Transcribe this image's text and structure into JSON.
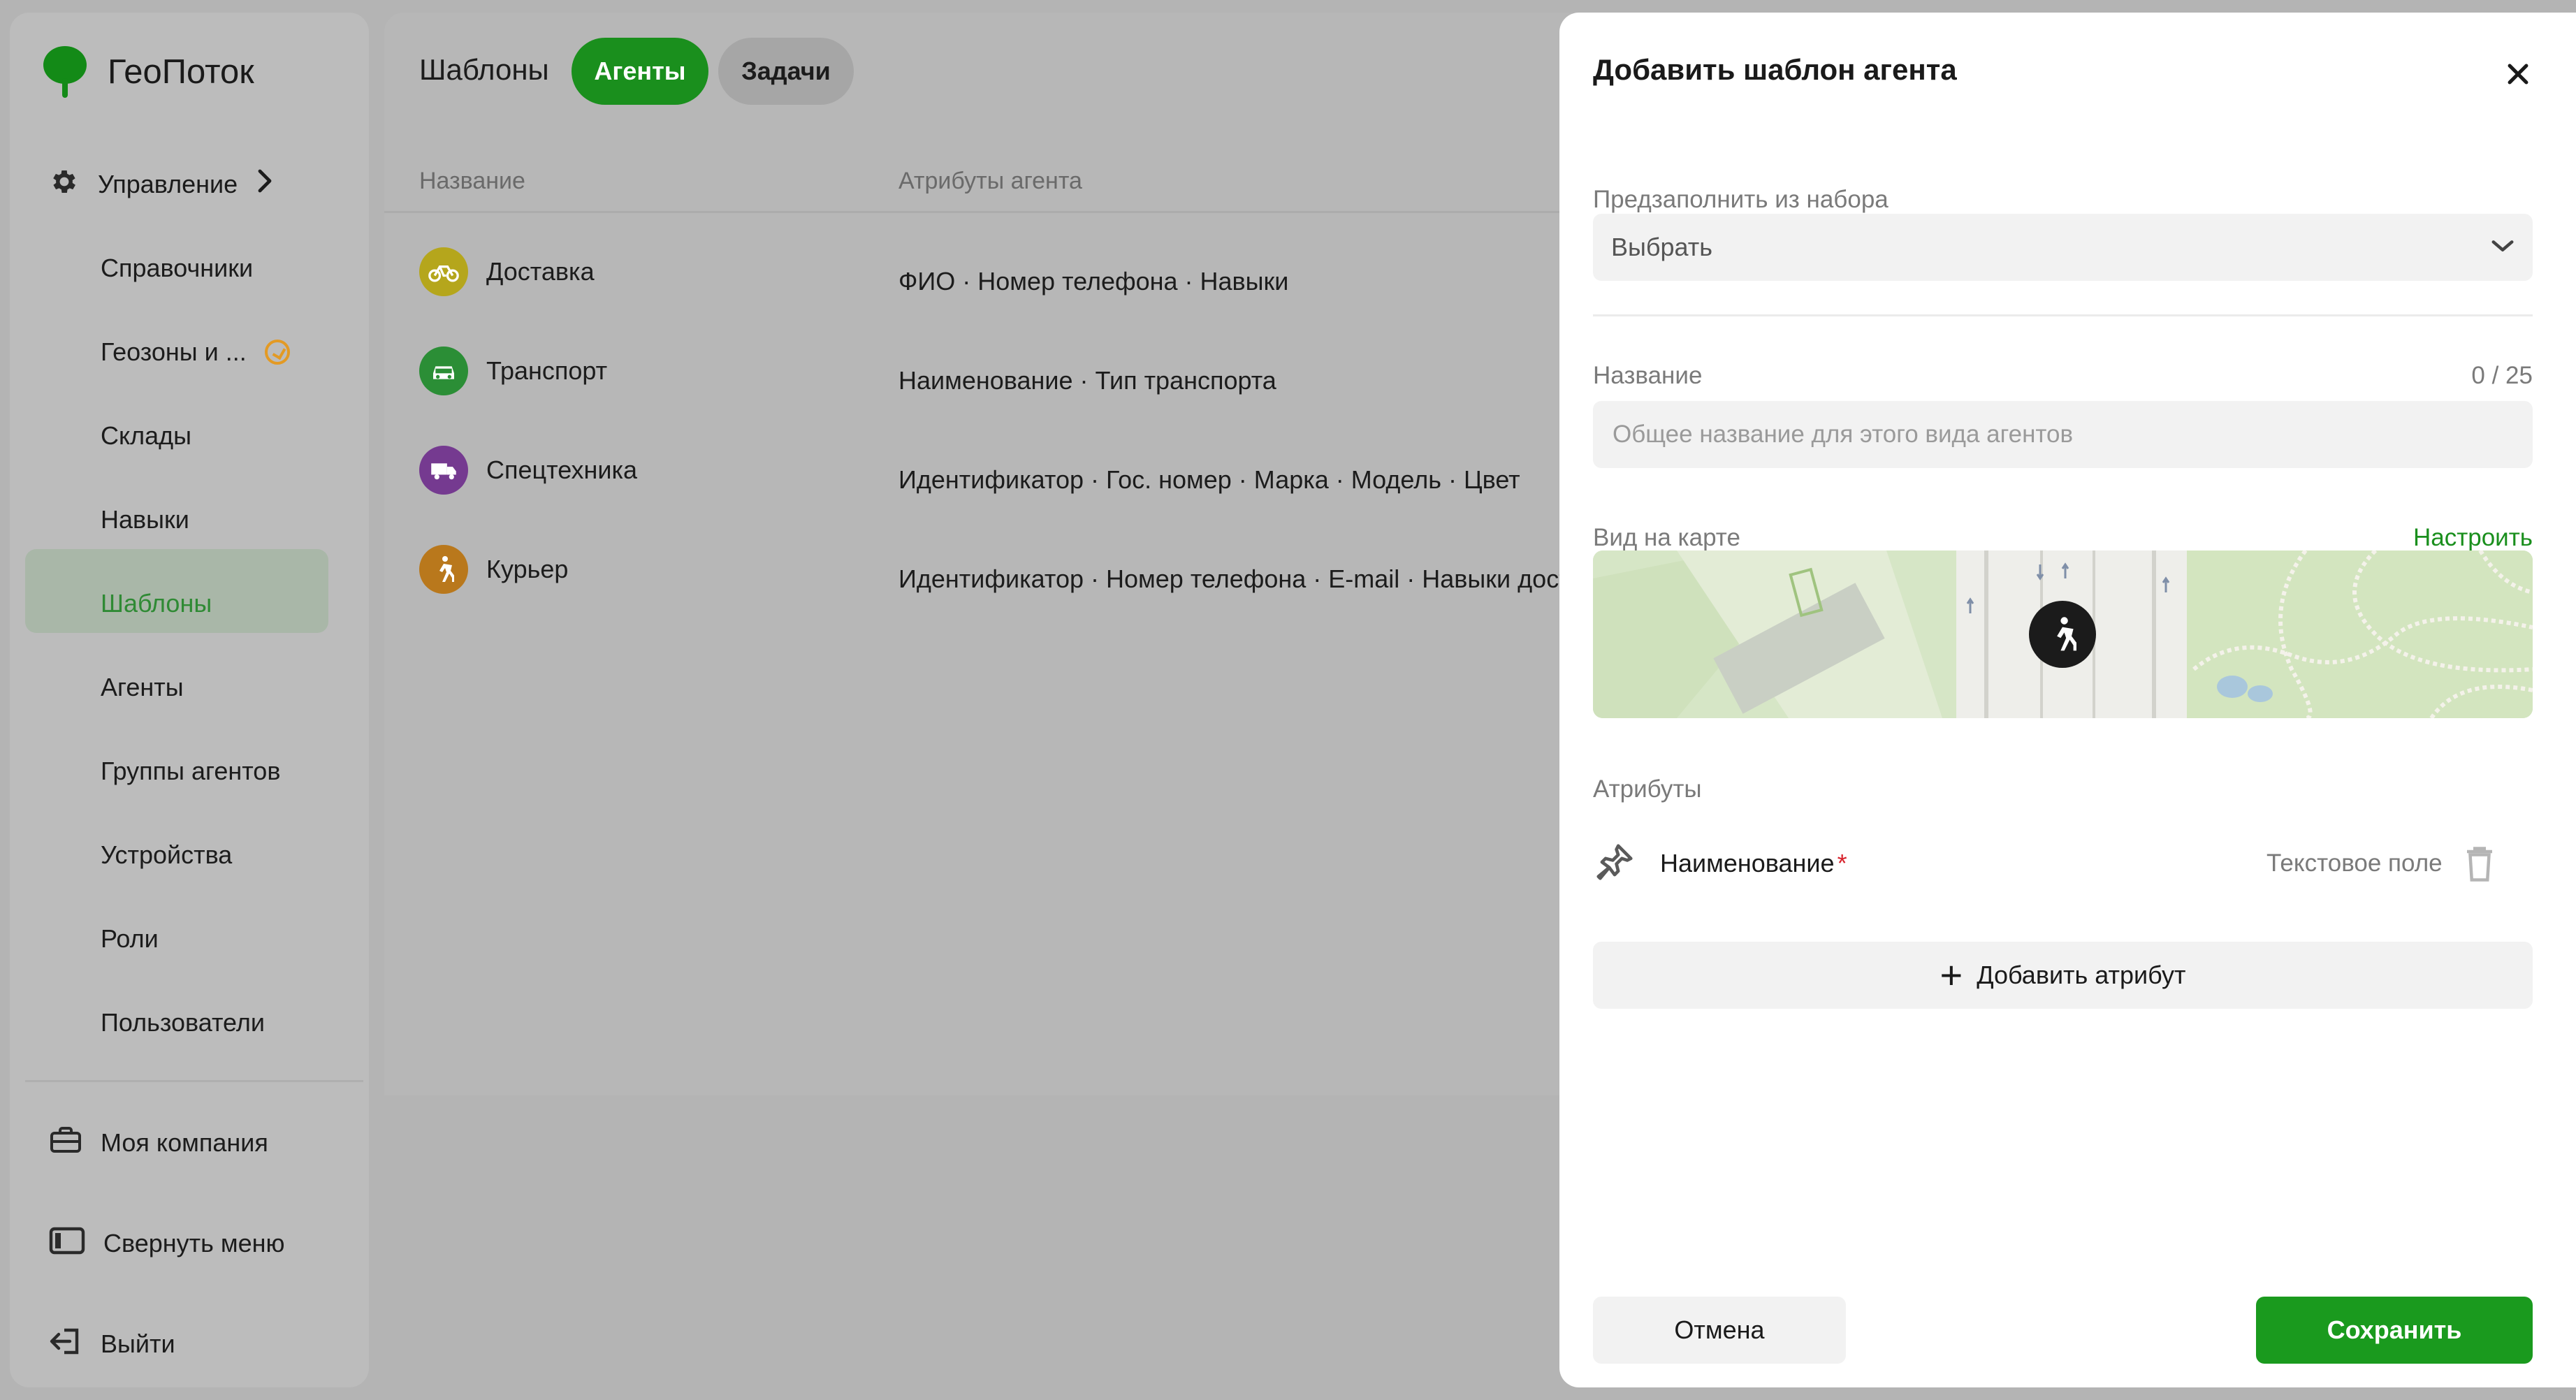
{
  "app": {
    "name": "ГеоПоток",
    "brand_color": "#1a8f1d"
  },
  "sidebar": {
    "management": {
      "label": "Управление",
      "icon": "gear-icon"
    },
    "items": [
      {
        "label": "Справочники"
      },
      {
        "label": "Геозоны и ...",
        "badge": "clock-icon",
        "badge_color": "#e39a24"
      },
      {
        "label": "Склады"
      },
      {
        "label": "Навыки"
      },
      {
        "label": "Шаблоны",
        "active": true
      },
      {
        "label": "Агенты"
      },
      {
        "label": "Группы агентов"
      },
      {
        "label": "Устройства"
      },
      {
        "label": "Роли"
      },
      {
        "label": "Пользователи"
      }
    ],
    "bottom": [
      {
        "label": "Моя компания",
        "icon": "briefcase-icon"
      },
      {
        "label": "Свернуть меню",
        "icon": "collapse-icon"
      },
      {
        "label": "Выйти",
        "icon": "logout-icon"
      }
    ]
  },
  "main": {
    "title": "Шаблоны",
    "tabs": [
      {
        "label": "Агенты",
        "active": true
      },
      {
        "label": "Задачи",
        "active": false
      }
    ],
    "columns": {
      "name": "Название",
      "attributes": "Атрибуты агента"
    },
    "rows": [
      {
        "name": "Доставка",
        "icon": "bicycle-icon",
        "color": "#c3b01e",
        "attributes": "ФИО · Номер телефона · Навыки"
      },
      {
        "name": "Транспорт",
        "icon": "car-icon",
        "color": "#2f9a3a",
        "attributes": "Наименование · Тип транспорта"
      },
      {
        "name": "Спецтехника",
        "icon": "truck-icon",
        "color": "#7d3f9a",
        "attributes": "Идентификатор · Гос. номер · Марка · Модель · Цвет"
      },
      {
        "name": "Курьер",
        "icon": "walker-icon",
        "color": "#c6841e",
        "attributes": "Идентификатор · Номер телефона · E-mail · Навыки доставки"
      }
    ]
  },
  "modal": {
    "title": "Добавить шаблон агента",
    "prefill": {
      "label": "Предзаполнить из набора",
      "value": "Выбрать"
    },
    "name_field": {
      "label": "Название",
      "counter": "0 / 25",
      "placeholder": "Общее название для этого вида агентов",
      "value": ""
    },
    "map_view": {
      "label": "Вид на карте",
      "configure": "Настроить",
      "marker_icon": "walker-icon"
    },
    "attributes": {
      "label": "Атрибуты",
      "items": [
        {
          "name": "Наименование",
          "required_mark": "*",
          "type": "Текстовое поле",
          "pinned": true
        }
      ],
      "add_label": "Добавить атрибут"
    },
    "cancel_label": "Отмена",
    "save_label": "Сохранить"
  }
}
